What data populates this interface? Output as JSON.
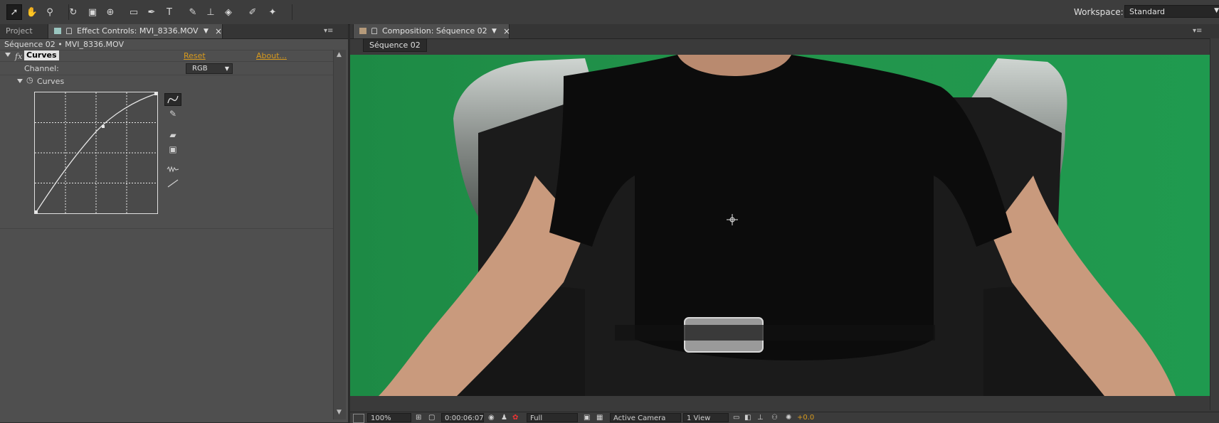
{
  "toolbar": {
    "tools": [
      {
        "name": "selection-tool-icon",
        "glyph": "➚",
        "active": true
      },
      {
        "name": "hand-tool-icon",
        "glyph": "✋"
      },
      {
        "name": "zoom-tool-icon",
        "glyph": "⚲"
      },
      {
        "name": "rotation-tool-icon",
        "glyph": "↻"
      },
      {
        "name": "camera-tool-icon",
        "glyph": "▣"
      },
      {
        "name": "pan-behind-tool-icon",
        "glyph": "⊕"
      },
      {
        "name": "rectangle-tool-icon",
        "glyph": "▭"
      },
      {
        "name": "pen-tool-icon",
        "glyph": "✒"
      },
      {
        "name": "type-tool-icon",
        "glyph": "T"
      },
      {
        "name": "brush-tool-icon",
        "glyph": "✎"
      },
      {
        "name": "clone-stamp-tool-icon",
        "glyph": "⊥"
      },
      {
        "name": "eraser-tool-icon",
        "glyph": "◈"
      },
      {
        "name": "roto-brush-tool-icon",
        "glyph": "✐"
      },
      {
        "name": "puppet-pin-tool-icon",
        "glyph": "✦"
      }
    ],
    "workspace_label": "Workspace:",
    "workspace_value": "Standard"
  },
  "left_panel": {
    "tabs": [
      {
        "label": "Project"
      },
      {
        "label": "Effect Controls: MVI_8336.MOV"
      }
    ],
    "layer_path": "Séquence 02 • MVI_8336.MOV",
    "effect": {
      "fx_badge": "fx",
      "name": "Curves",
      "reset_label": "Reset",
      "about_label": "About...",
      "channel_label": "Channel:",
      "channel_value": "RGB",
      "curves_label": "Curves"
    }
  },
  "right_panel": {
    "tab_label": "Composition: Séquence 02",
    "sequence_tab": "Séquence 02",
    "bottom_bar": {
      "zoom": "100%",
      "timecode": "0:00:06:07",
      "resolution": "Full",
      "camera": "Active Camera",
      "views": "1 View",
      "exposure": "+0.0"
    }
  },
  "colors": {
    "accent_link": "#d79a1e",
    "green_screen": "#1f8a44",
    "layer_swatch": "#9ac6c0",
    "comp_swatch": "#b59a7a"
  }
}
